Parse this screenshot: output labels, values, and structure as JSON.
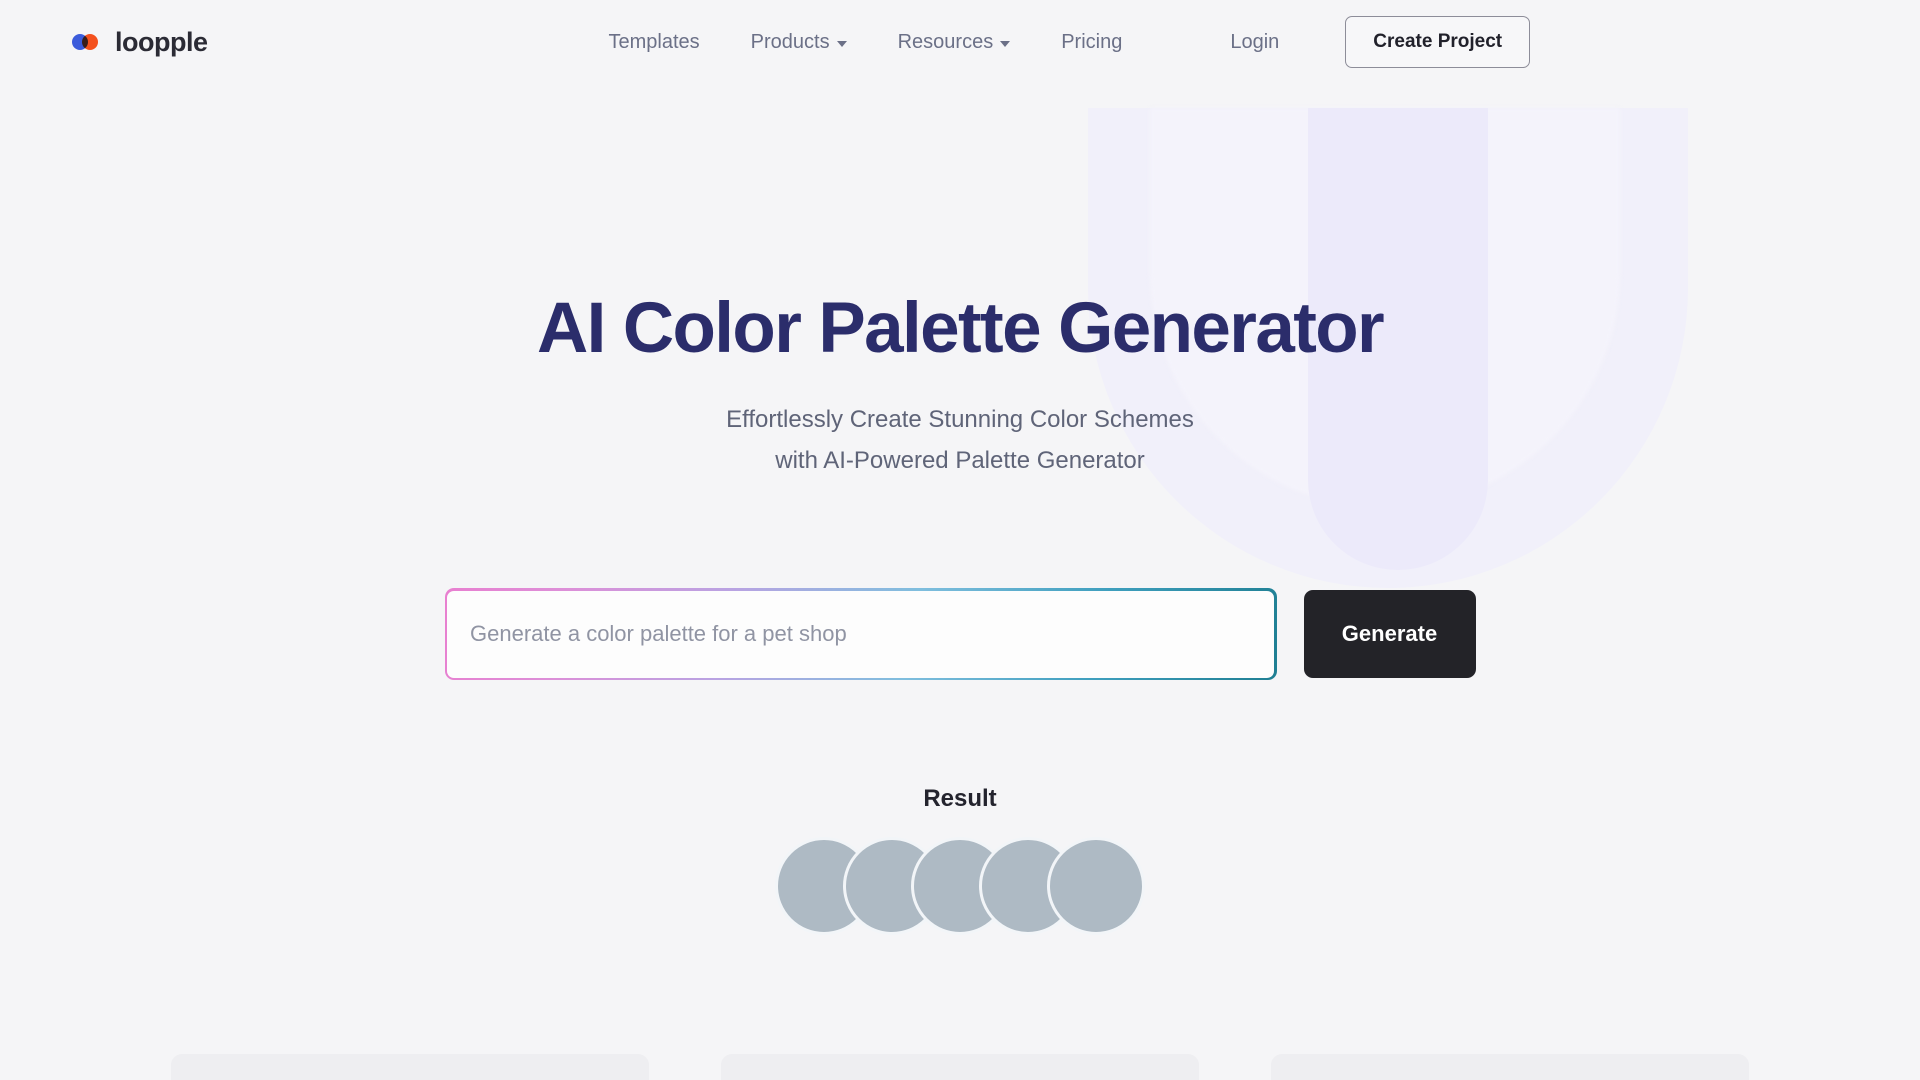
{
  "brand": {
    "name": "loopple",
    "logo_dot_primary": "#3b5bdb",
    "logo_dot_secondary": "#f4511e"
  },
  "nav": {
    "items": [
      {
        "label": "Templates",
        "has_dropdown": false
      },
      {
        "label": "Products",
        "has_dropdown": true
      },
      {
        "label": "Resources",
        "has_dropdown": true
      },
      {
        "label": "Pricing",
        "has_dropdown": false
      }
    ],
    "login_label": "Login",
    "cta_label": "Create Project"
  },
  "hero": {
    "title": "AI Color Palette Generator",
    "subtitle_line1": "Effortlessly Create Stunning Color Schemes",
    "subtitle_line2": "with AI-Powered Palette Generator",
    "title_color": "#2b2d6b",
    "subtitle_color": "#5f6478"
  },
  "search": {
    "placeholder": "Generate a color palette for a pet shop",
    "value": "",
    "button_label": "Generate",
    "button_bg": "#232328",
    "border_gradient_start": "#e87fd0",
    "border_gradient_end": "#1f7f93"
  },
  "result": {
    "label": "Result",
    "swatches": [
      {
        "index": 1,
        "color": "#aebac4"
      },
      {
        "index": 2,
        "color": "#aebac4"
      },
      {
        "index": 3,
        "color": "#aebac4"
      },
      {
        "index": 4,
        "color": "#aebac4"
      },
      {
        "index": 5,
        "color": "#aebac4"
      }
    ]
  },
  "page": {
    "background": "#f5f5f7",
    "decoration_color": "#f1f0fa"
  }
}
